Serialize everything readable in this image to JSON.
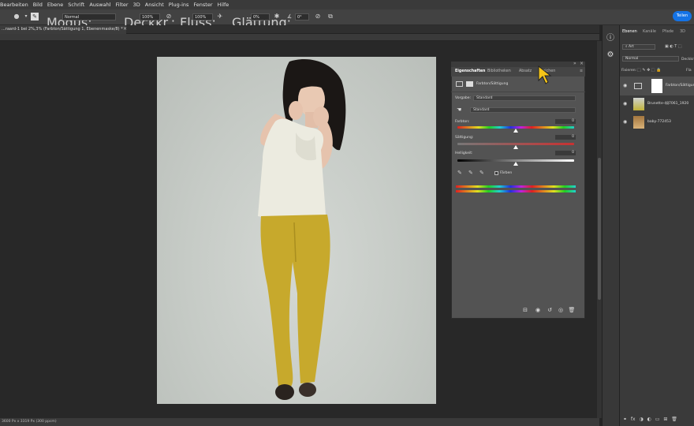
{
  "menu": [
    "Bearbeiten",
    "Bild",
    "Ebene",
    "Schrift",
    "Auswahl",
    "Filter",
    "3D",
    "Ansicht",
    "Plug-ins",
    "Fenster",
    "Hilfe"
  ],
  "options": {
    "modus_label": "Modus:",
    "modus_value": "Normal",
    "deckkraft_label": "Deckkr.:",
    "deckkraft_value": "100%",
    "fluss_label": "Fluss:",
    "fluss_value": "100%",
    "glaettung_label": "Glättung:",
    "glaettung_value": "0%",
    "angle_value": "0°",
    "share_label": "Teilen"
  },
  "document_tab": "...raard-1 bei 2%,3% (Farbton/Sättigung 1, Ebenenmaske/8) *",
  "status": "3600 Px x 3319 Px (300 ppcm)",
  "properties": {
    "tabs": [
      "Eigenschaften",
      "Bibliotheken",
      "Absatz",
      "Zeichen"
    ],
    "title": "Farbton/Sättigung",
    "vorgabe_label": "Vorgabe:",
    "vorgabe_value": "Standard",
    "channel_value": "Standard",
    "sliders": [
      {
        "label": "Farbton:",
        "value": "0",
        "level": 0.5
      },
      {
        "label": "Sättigung:",
        "value": "0",
        "level": 0.5
      },
      {
        "label": "Helligkeit:",
        "value": "0",
        "level": 0.5
      }
    ],
    "faerben_label": "Färben"
  },
  "right_panel": {
    "tabs": [
      "Ebenen",
      "Kanäle",
      "Pfade",
      "3D"
    ],
    "search_value": "Art",
    "blend_value": "Normal",
    "blend_right": "Deckkr",
    "fixieren_label": "Fixieren:",
    "fixieren_right": "Fla",
    "layers": [
      {
        "name": "Farbton/Sättigung ..."
      },
      {
        "name": "Brunette-487061_1920"
      },
      {
        "name": "baby-772453"
      }
    ]
  }
}
